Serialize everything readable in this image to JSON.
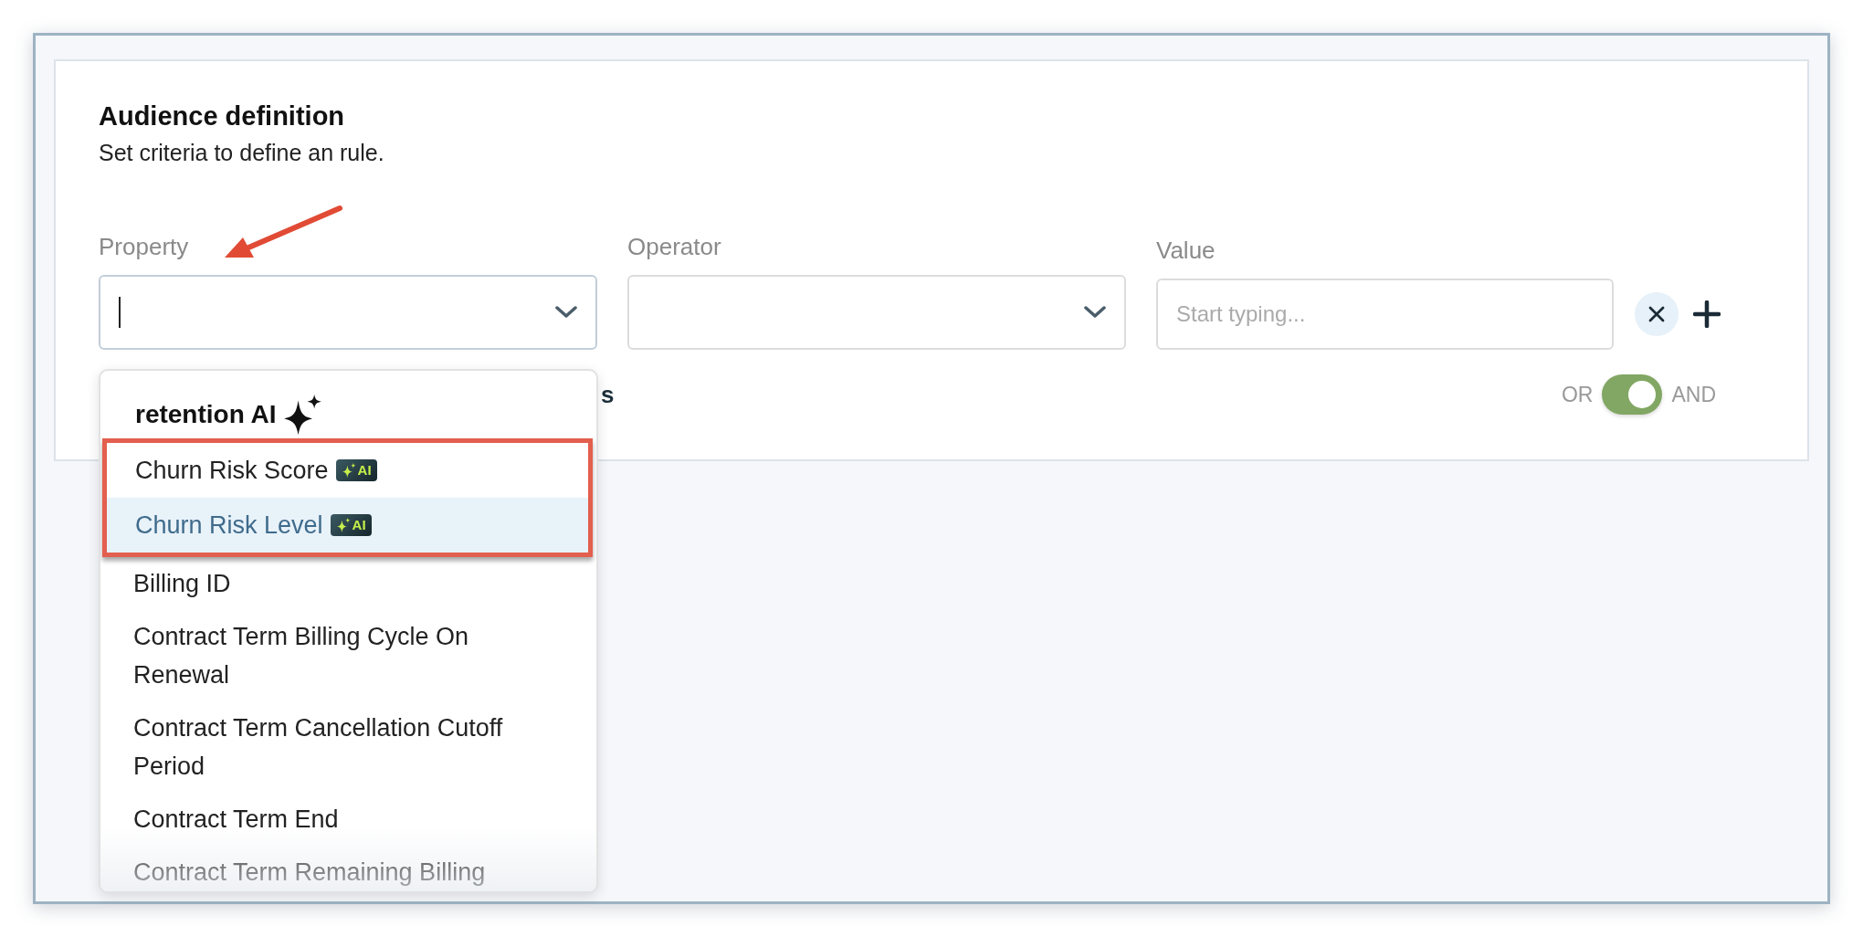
{
  "card": {
    "title": "Audience definition",
    "subtitle": "Set criteria to define an rule."
  },
  "fields": [
    {
      "kind": "select",
      "label": "Property",
      "focused": true
    },
    {
      "kind": "select",
      "label": "Operator",
      "focused": false
    },
    {
      "kind": "text",
      "label": "Value",
      "placeholder": "Start typing...",
      "focused": false
    }
  ],
  "covered_text": "s",
  "toggle": {
    "left_label": "OR",
    "right_label": "AND",
    "on": true
  },
  "dropdown": {
    "group_title": "retention AI",
    "items": [
      {
        "label": "Churn Risk Score",
        "badge": "AI",
        "selected": false,
        "annotated": true
      },
      {
        "label": "Churn Risk Level",
        "badge": "AI",
        "selected": true,
        "annotated": true
      },
      {
        "label": "Billing ID",
        "selected": false,
        "annotated": false
      },
      {
        "label": "Contract Term Billing Cycle On Renewal",
        "selected": false,
        "annotated": false
      },
      {
        "label": "Contract Term Cancellation Cutoff Period",
        "selected": false,
        "annotated": false
      },
      {
        "label": "Contract Term End",
        "selected": false,
        "annotated": false
      },
      {
        "label": "Contract Term Remaining Billing",
        "selected": false,
        "annotated": false
      }
    ]
  }
}
